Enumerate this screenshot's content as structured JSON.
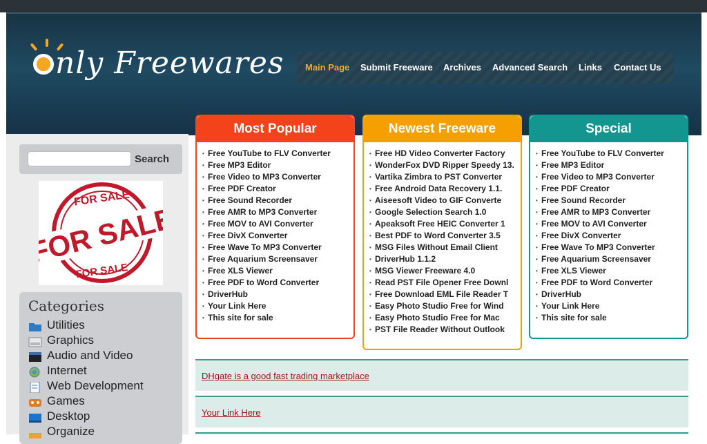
{
  "site": {
    "logo_text": "nly Freewares",
    "nav": [
      {
        "label": "Main Page",
        "active": true
      },
      {
        "label": "Submit Freeware"
      },
      {
        "label": "Archives"
      },
      {
        "label": "Advanced Search"
      },
      {
        "label": "Links"
      },
      {
        "label": "Contact Us"
      }
    ]
  },
  "sidebar": {
    "search_button": "Search",
    "for_sale_text": "FOR SALE",
    "categories_title": "Categories",
    "categories": [
      {
        "label": "Utilities",
        "icon": "folder-icon"
      },
      {
        "label": "Graphics",
        "icon": "graphics-icon"
      },
      {
        "label": "Audio and Video",
        "icon": "clapperboard-icon"
      },
      {
        "label": "Internet",
        "icon": "globe-icon"
      },
      {
        "label": "Web Development",
        "icon": "document-icon"
      },
      {
        "label": "Games",
        "icon": "games-icon"
      },
      {
        "label": "Desktop",
        "icon": "desktop-icon"
      },
      {
        "label": "Organize",
        "icon": "organize-icon"
      }
    ]
  },
  "boxes": {
    "popular": {
      "title": "Most Popular",
      "color": "#f4421a",
      "items": [
        "Free YouTube to FLV Converter",
        "Free MP3 Editor",
        "Free Video to MP3 Converter",
        "Free PDF Creator",
        "Free Sound Recorder",
        "Free AMR to MP3 Converter",
        "Free MOV to AVI Converter",
        "Free DivX Converter",
        "Free Wave To MP3 Converter",
        "Free Aquarium Screensaver",
        "Free XLS Viewer",
        "Free PDF to Word Converter",
        "DriverHub",
        "Your Link Here",
        "This site for sale"
      ]
    },
    "newest": {
      "title": "Newest Freeware",
      "color": "#f5a000",
      "items": [
        "Free HD Video Converter Factory",
        "WonderFox DVD Ripper Speedy 13.",
        "Vartika Zimbra to PST Converter",
        "Free Android Data Recovery 1.1.",
        "Aiseesoft Video to GIF Converte",
        "Google Selection Search 1.0",
        "Apeaksoft Free HEIC Converter 1",
        "Best PDF to Word Converter 3.5",
        "MSG Files Without Email Client",
        "DriverHub 1.1.2",
        "MSG Viewer Freeware 4.0",
        "Read PST File Opener Free Downl",
        "Free Download EML File Reader T",
        "Easy Photo Studio Free for Wind",
        "Easy Photo Studio Free for Mac",
        "PST File Reader Without Outlook"
      ]
    },
    "special": {
      "title": "Special",
      "color": "#12968f",
      "items": [
        "Free YouTube to FLV Converter",
        "Free MP3 Editor",
        "Free Video to MP3 Converter",
        "Free PDF Creator",
        "Free Sound Recorder",
        "Free AMR to MP3 Converter",
        "Free MOV to AVI Converter",
        "Free DivX Converter",
        "Free Wave To MP3 Converter",
        "Free Aquarium Screensaver",
        "Free XLS Viewer",
        "Free PDF to Word Converter",
        "DriverHub",
        "Your Link Here",
        "This site for sale"
      ]
    }
  },
  "links": [
    "DHgate is a good fast trading marketplace",
    "Your Link Here"
  ]
}
